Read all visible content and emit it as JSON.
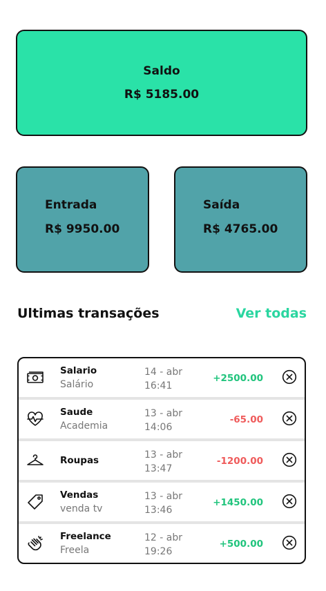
{
  "balance": {
    "title": "Saldo",
    "value": "R$ 5185.00"
  },
  "income": {
    "title": "Entrada",
    "value": "R$ 9950.00"
  },
  "expense": {
    "title": "Saída",
    "value": "R$ 4765.00"
  },
  "transactions_section": {
    "title": "Ultimas transações",
    "see_all": "Ver todas"
  },
  "colors": {
    "balance_card": "#2ae2a8",
    "summary_card": "#51a3a9",
    "positive": "#21c47d",
    "negative": "#ef5b5b",
    "link": "#2ad6a0"
  },
  "transactions": [
    {
      "icon": "money-icon",
      "name": "Salario",
      "category": "Salário",
      "date": "14 - abr",
      "time": "16:41",
      "amount": "+2500.00",
      "type": "positive"
    },
    {
      "icon": "heartbeat-icon",
      "name": "Saude",
      "category": "Academia",
      "date": "13 - abr",
      "time": "14:06",
      "amount": "-65.00",
      "type": "negative"
    },
    {
      "icon": "hanger-icon",
      "name": "Roupas",
      "category": "",
      "date": "13 - abr",
      "time": "13:47",
      "amount": "-1200.00",
      "type": "negative"
    },
    {
      "icon": "tag-icon",
      "name": "Vendas",
      "category": "venda tv",
      "date": "13 - abr",
      "time": "13:46",
      "amount": "+1450.00",
      "type": "positive"
    },
    {
      "icon": "clapping-hand-icon",
      "name": "Freelance",
      "category": "Freela",
      "date": "12 - abr",
      "time": "19:26",
      "amount": "+500.00",
      "type": "positive"
    }
  ]
}
